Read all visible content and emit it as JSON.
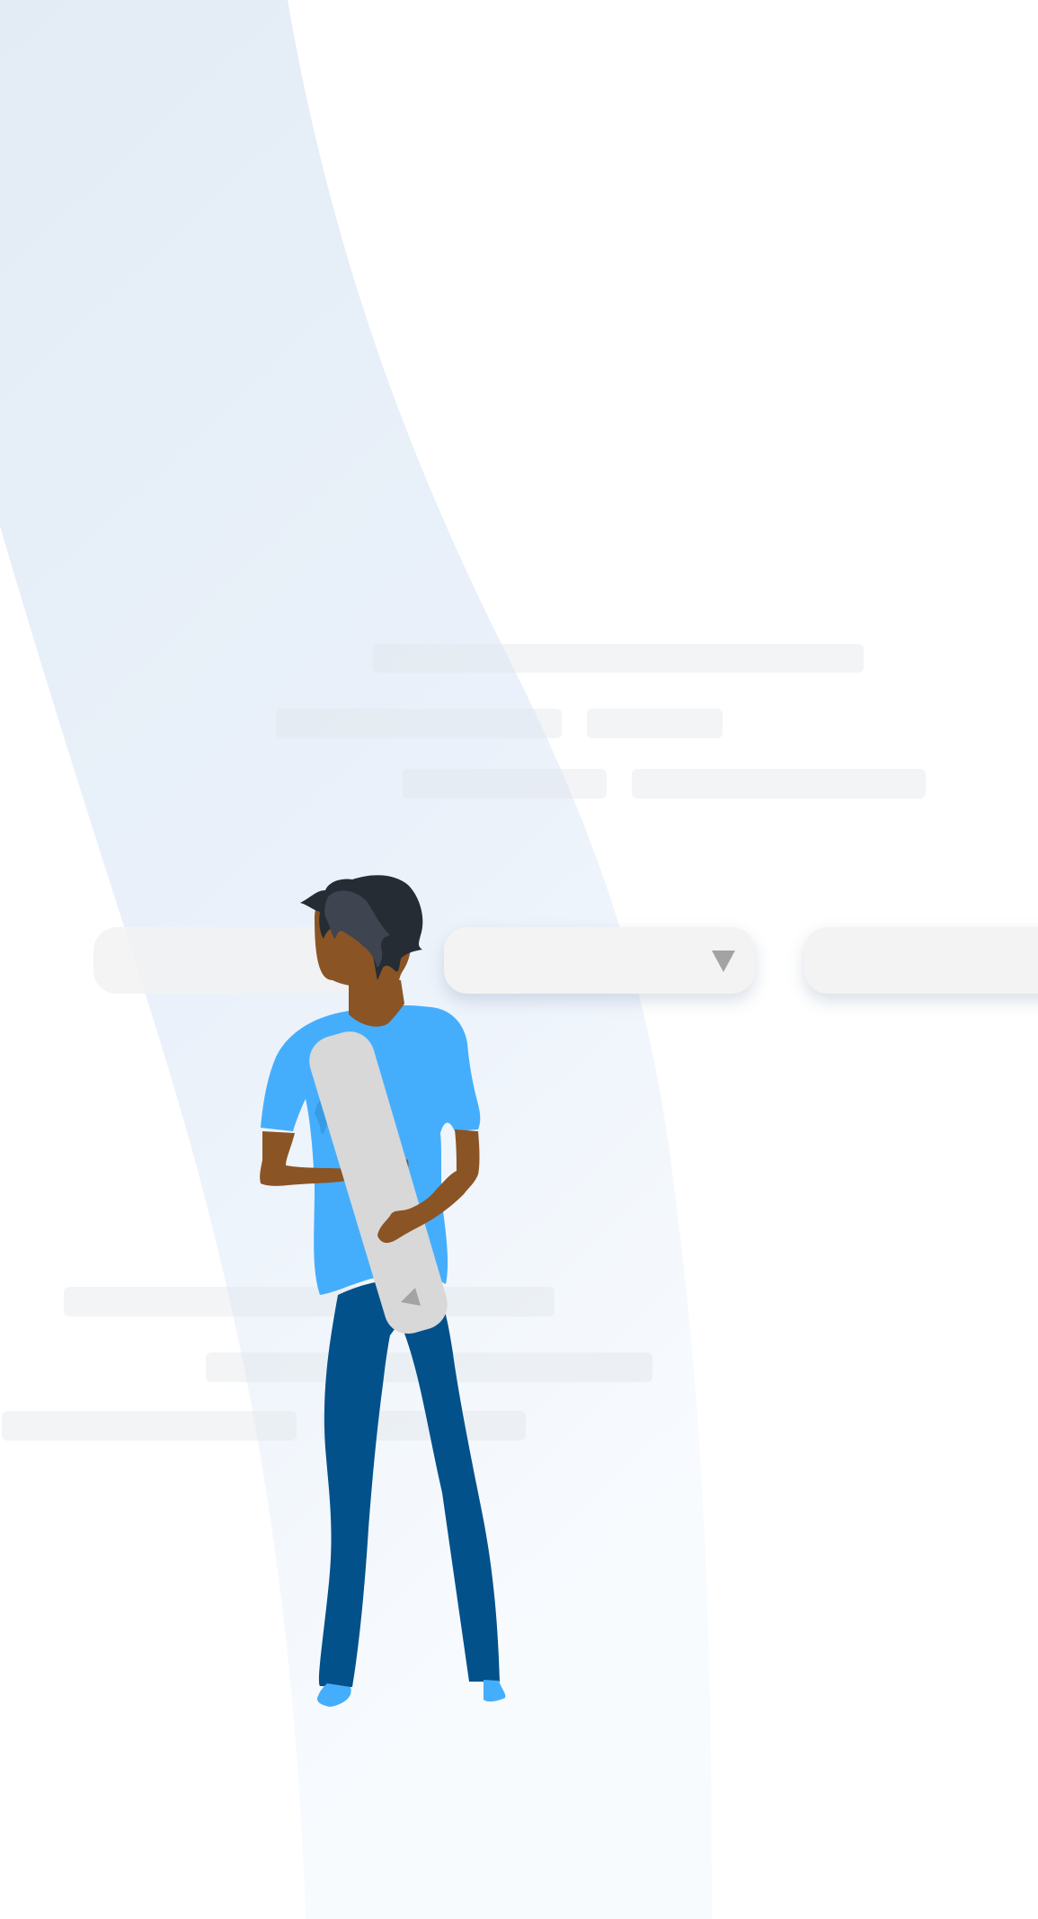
{
  "page": {
    "colors": {
      "background": "#ffffff",
      "wave_top": "#e4edf6",
      "wave_bottom": "#f6f9fd",
      "skeleton": "#eceef1",
      "pill": "#f2f2f2",
      "caret": "#a3a3a3",
      "skin": "#8b5424",
      "hair": "#262c34",
      "shirt": "#45aefc",
      "pants": "#03518a",
      "board": "#d8d8d8"
    }
  },
  "form": {
    "dropdowns": [
      {
        "icon": "chevron-down-icon",
        "value": ""
      }
    ]
  },
  "illustration": {
    "subject": "person-holding-board",
    "board_icon": "triangle-icon"
  }
}
